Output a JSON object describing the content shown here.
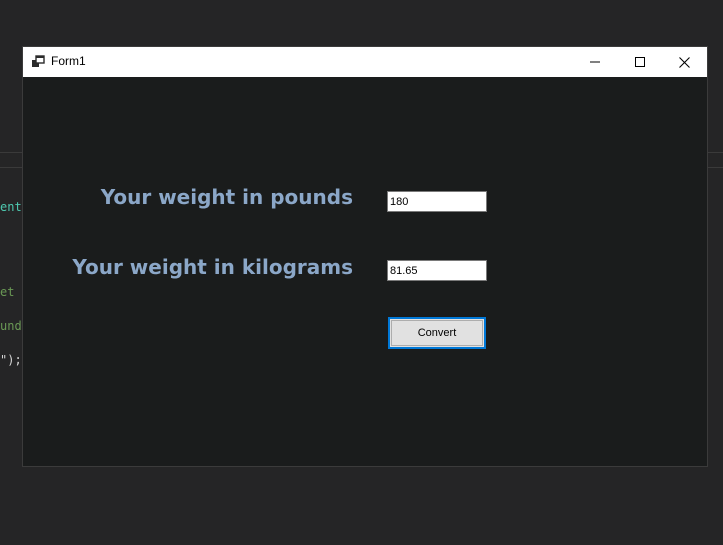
{
  "background_code": {
    "fragments": [
      {
        "text": "ent",
        "color": "#4ec9b0"
      },
      {
        "text": "et ",
        "color": "#6a9955"
      },
      {
        "text": "und",
        "color": "#6a9955"
      },
      {
        "text": "\");",
        "color": "#d4d4d4"
      }
    ]
  },
  "window": {
    "title": "Form1",
    "icons": {
      "app": "form-icon",
      "minimize": "minimize-icon",
      "maximize": "maximize-icon",
      "close": "close-icon"
    }
  },
  "form": {
    "pounds_label": "Your weight in pounds",
    "pounds_value": "180",
    "kilograms_label": "Your weight in kilograms",
    "kilograms_value": "81.65",
    "convert_label": "Convert"
  },
  "colors": {
    "form_background": "#1a1c1c",
    "label_text": "#8ba7c8",
    "button_focus": "#0078d7"
  }
}
